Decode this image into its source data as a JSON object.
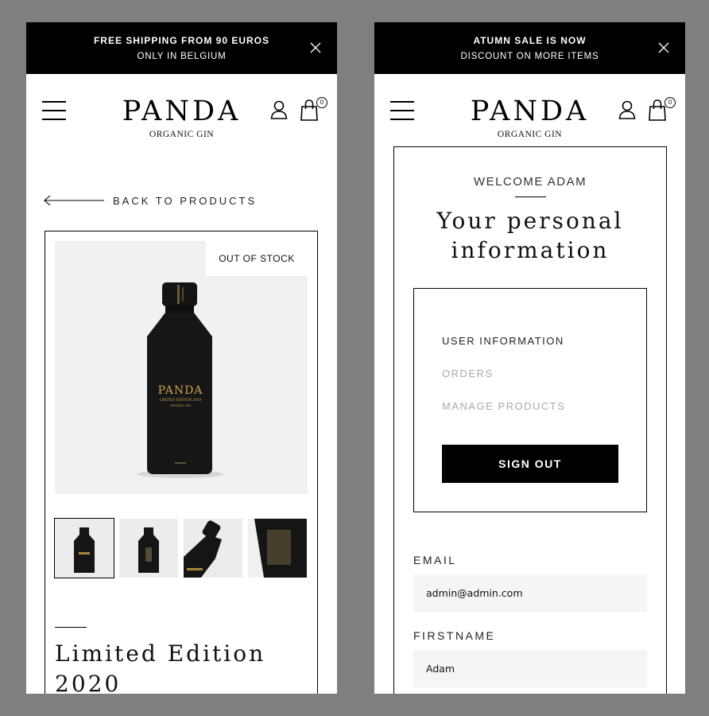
{
  "left": {
    "banner": {
      "line1": "FREE SHIPPING FROM 90 EUROS",
      "line2": "ONLY IN BELGIUM"
    },
    "header": {
      "logo": "PANDA",
      "logo_sub": "ORGANIC GIN",
      "cart_count": "0"
    },
    "back_label": "BACK TO PRODUCTS",
    "product": {
      "stock_badge": "OUT OF STOCK",
      "bottle_brand": "PANDA",
      "bottle_edition": "LIMITED EDITION 2020",
      "bottle_type": "ORGANIC GIN",
      "title": "Limited Edition 2020"
    }
  },
  "right": {
    "banner": {
      "line1": "ATUMN SALE IS NOW",
      "line2": "DISCOUNT ON MORE ITEMS"
    },
    "header": {
      "logo": "PANDA",
      "logo_sub": "ORGANIC GIN",
      "cart_count": "0"
    },
    "welcome": "WELCOME ADAM",
    "heading": "Your personal information",
    "menu": {
      "items": [
        "USER INFORMATION",
        "ORDERS",
        "MANAGE PRODUCTS"
      ],
      "signout": "SIGN OUT"
    },
    "form": {
      "email_label": "EMAIL",
      "email_value": "admin@admin.com",
      "firstname_label": "FIRSTNAME",
      "firstname_value": "Adam"
    }
  },
  "icons": [
    "close-icon",
    "hamburger-menu-icon",
    "user-icon",
    "shopping-bag-icon",
    "arrow-left-icon"
  ],
  "colors": {
    "banner_bg": "#000000",
    "page_bg": "#7f7f7f",
    "input_bg": "#f5f5f5",
    "gold": "#c8a24a"
  }
}
